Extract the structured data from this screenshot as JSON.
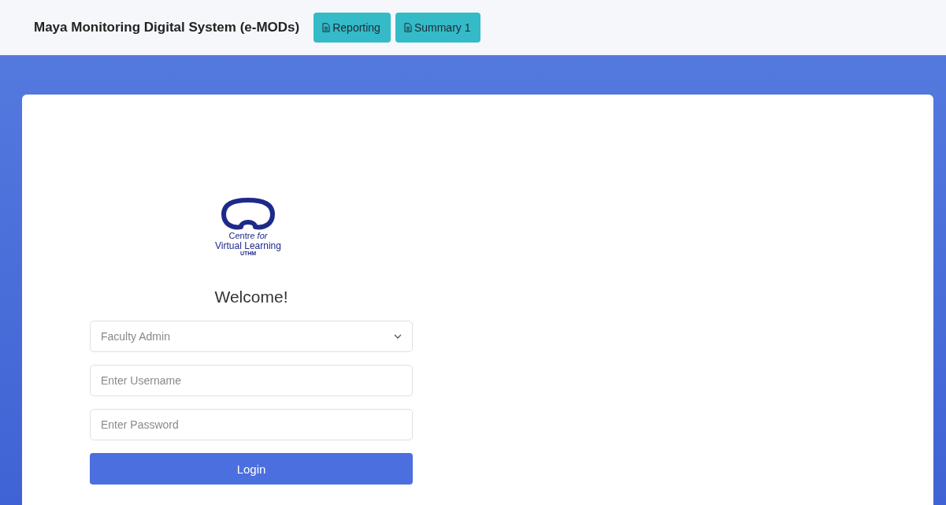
{
  "header": {
    "title": "Maya Monitoring Digital System (e-MODs)",
    "buttons": [
      "Reporting",
      "Summary 1"
    ]
  },
  "logo": {
    "line_1": "Centre *for*",
    "line_2": "Virtual Learning",
    "line_3": "UTHM"
  },
  "login": {
    "heading": "Welcome!",
    "role_select": {
      "value": "Faculty Admin"
    },
    "username": {
      "placeholder": "Enter Username"
    },
    "password": {
      "placeholder": "Enter Password"
    },
    "button": "Login"
  }
}
